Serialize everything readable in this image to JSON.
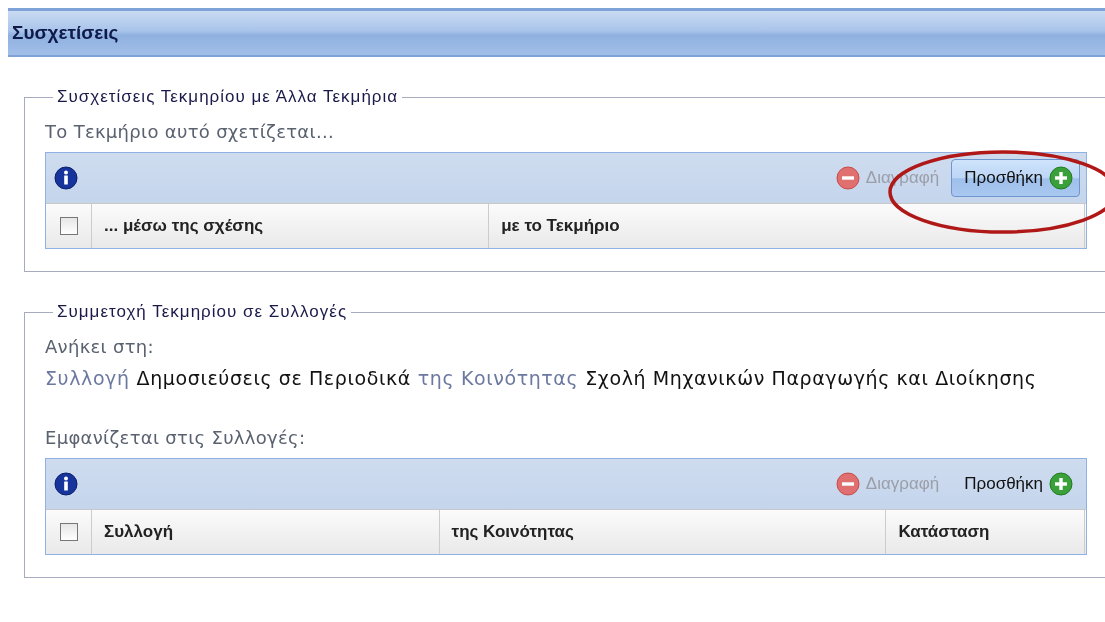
{
  "header": {
    "title": "Συσχετίσεις"
  },
  "sections": [
    {
      "legend": "Συσχετίσεις Τεκμηρίου με Άλλα Τεκμήρια",
      "blocks": [
        {
          "kind": "text",
          "text": "Το Τεκμήριο αυτό σχετίζεται..."
        },
        {
          "kind": "grid",
          "delete_label": "Διαγραφή",
          "add_label": "Προσθήκη",
          "add_highlighted": true,
          "select_all_checked": false,
          "columns": [
            {
              "label": "... μέσω της σχέσης"
            },
            {
              "label": "με το Τεκμήριο"
            }
          ]
        }
      ]
    },
    {
      "legend": "Συμμετοχή Τεκμηρίου σε Συλλογές",
      "blocks": [
        {
          "kind": "text",
          "text": "Ανήκει στη:"
        },
        {
          "kind": "membership",
          "parts": [
            {
              "kind": "label",
              "text": "Συλλογή"
            },
            {
              "kind": "value",
              "text": "Δημοσιεύσεις σε Περιοδικά"
            },
            {
              "kind": "label",
              "text": "της Κοινότητας"
            },
            {
              "kind": "value",
              "text": "Σχολή Μηχανικών Παραγωγής και Διοίκησης"
            }
          ]
        },
        {
          "kind": "spacer"
        },
        {
          "kind": "text",
          "text": "Εμφανίζεται στις Συλλογές:"
        },
        {
          "kind": "grid",
          "delete_label": "Διαγραφή",
          "add_label": "Προσθήκη",
          "add_highlighted": false,
          "select_all_checked": false,
          "columns": [
            {
              "label": "Συλλογή"
            },
            {
              "label": "της Κοινότητας"
            },
            {
              "label": "Κατάσταση"
            }
          ]
        }
      ]
    }
  ]
}
